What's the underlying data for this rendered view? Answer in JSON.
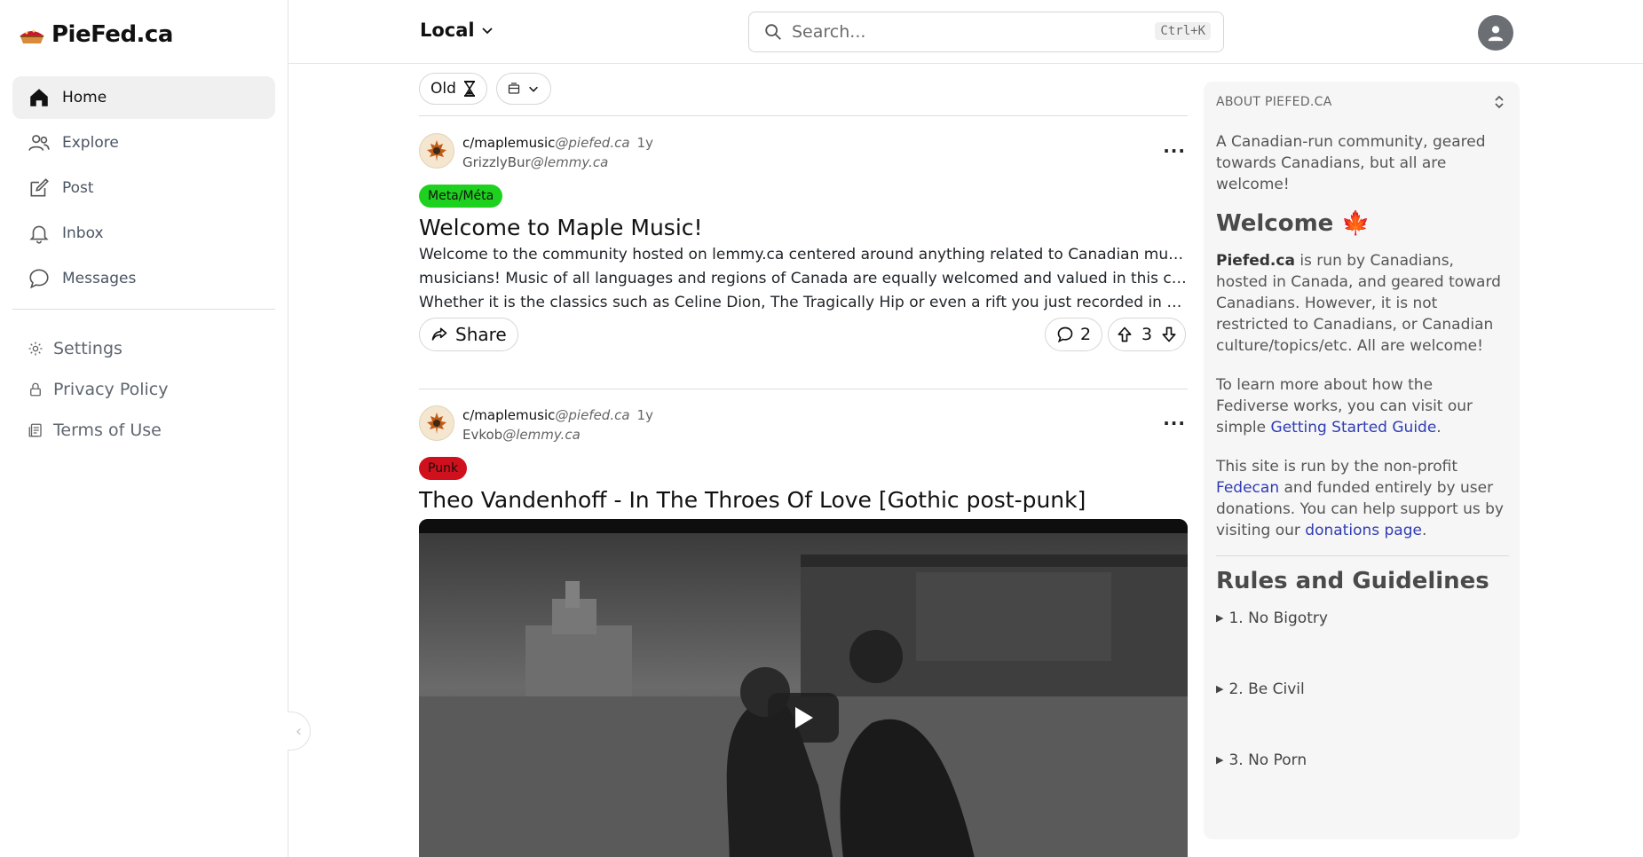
{
  "brand": {
    "name": "PieFed.ca"
  },
  "nav": {
    "items": [
      {
        "label": "Home",
        "icon": "home-icon"
      },
      {
        "label": "Explore",
        "icon": "users-icon"
      },
      {
        "label": "Post",
        "icon": "edit-icon"
      },
      {
        "label": "Inbox",
        "icon": "bell-icon"
      },
      {
        "label": "Messages",
        "icon": "chat-icon"
      }
    ],
    "secondary": [
      {
        "label": "Settings",
        "icon": "gear-icon"
      },
      {
        "label": "Privacy Policy",
        "icon": "lock-icon"
      },
      {
        "label": "Terms of Use",
        "icon": "document-icon"
      }
    ]
  },
  "header": {
    "feed": "Local",
    "search_placeholder": "Search...",
    "shortcut": "Ctrl+K"
  },
  "sort": {
    "label": "Old"
  },
  "posts": [
    {
      "community": "c/maplemusic",
      "community_instance": "@piefed.ca",
      "time": "1y",
      "author": "GrizzlyBur",
      "author_instance": "@lemmy.ca",
      "flair": "Meta/Méta",
      "flair_color": "#1fd11f",
      "title": "Welcome to Maple Music!",
      "body": [
        "Welcome to the community hosted on lemmy.ca centered around anything related to Canadian music and",
        "musicians! Music of all languages and regions of Canada are equally welcomed and valued in this community.",
        "Whether it is the classics such as Celine Dion, The Tragically Hip or even a rift you just recorded in your garage..."
      ],
      "share_label": "Share",
      "comments": "2",
      "score": "3"
    },
    {
      "community": "c/maplemusic",
      "community_instance": "@piefed.ca",
      "time": "1y",
      "author": "Evkob",
      "author_instance": "@lemmy.ca",
      "flair": "Punk",
      "flair_color": "#d0101d",
      "title": "Theo Vandenhoff - In The Throes Of Love [Gothic post-punk]"
    }
  ],
  "aside": {
    "heading": "ABOUT PIEFED.CA",
    "intro": "A Canadian-run community, geared towards Canadians, but all are welcome!",
    "welcome_title": "Welcome 🍁",
    "p1_bold": "Piefed.ca",
    "p1_rest": " is run by Canadians, hosted in Canada, and geared toward Canadians. However, it is not restricted to Canadians, or Canadian culture/topics/etc. All are welcome!",
    "p2_text": "To learn more about how the Fediverse works, you can visit our simple ",
    "p2_link": "Getting Started Guide",
    "p2_end": ".",
    "p3_text": "This site is run by the non-profit ",
    "p3_link1": "Fedecan",
    "p3_mid": " and funded entirely by user donations. You can help support us by visiting our ",
    "p3_link2": "donations page",
    "p3_end": ".",
    "rules_title": "Rules and Guidelines",
    "rules": [
      "1. No Bigotry",
      "2. Be Civil",
      "3. No Porn"
    ]
  }
}
